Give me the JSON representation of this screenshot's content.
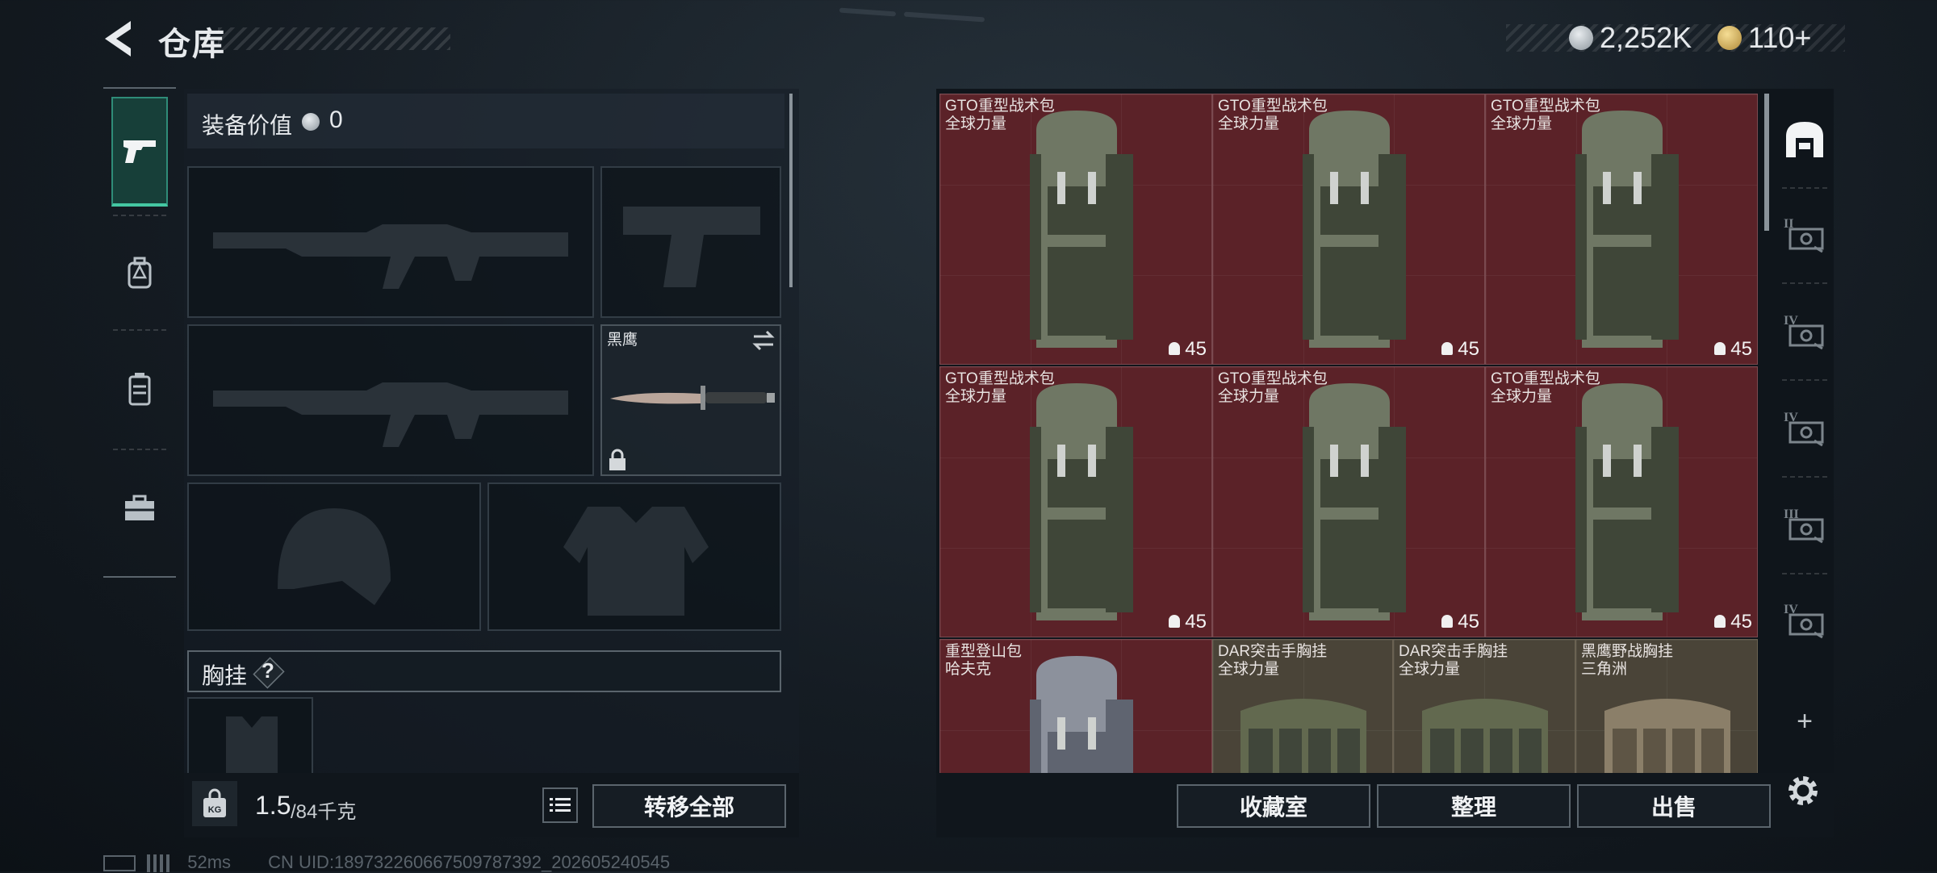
{
  "header": {
    "title": "仓库",
    "silver_amount": "2,252K",
    "gold_amount": "110+"
  },
  "tabs": [
    {
      "name": "firearms",
      "icon": "pistol-icon",
      "active": true
    },
    {
      "name": "gear",
      "icon": "backpack-icon",
      "active": false
    },
    {
      "name": "vest",
      "icon": "vest-icon",
      "active": false
    },
    {
      "name": "case",
      "icon": "toolbox-icon",
      "active": false
    }
  ],
  "equipment": {
    "value_label": "装备价值",
    "value": "0",
    "knife_name": "黑鹰",
    "chest_label": "胸挂",
    "help_label": "?",
    "weight_current": "1.5",
    "weight_max": "/84千克",
    "weight_icon_label": "KG",
    "transfer_all": "转移全部"
  },
  "inventory": {
    "items": [
      {
        "name": "GTO重型战术包",
        "sub": "全球力量",
        "count": "45",
        "kind": "backpack"
      },
      {
        "name": "GTO重型战术包",
        "sub": "全球力量",
        "count": "45",
        "kind": "backpack"
      },
      {
        "name": "GTO重型战术包",
        "sub": "全球力量",
        "count": "45",
        "kind": "backpack"
      },
      {
        "name": "GTO重型战术包",
        "sub": "全球力量",
        "count": "45",
        "kind": "backpack"
      },
      {
        "name": "GTO重型战术包",
        "sub": "全球力量",
        "count": "45",
        "kind": "backpack"
      },
      {
        "name": "GTO重型战术包",
        "sub": "全球力量",
        "count": "45",
        "kind": "backpack"
      },
      {
        "name": "重型登山包",
        "sub": "哈夫克",
        "count": "",
        "kind": "backpack-grey"
      },
      {
        "name": "DAR突击手胸挂",
        "sub": "全球力量",
        "count": "",
        "kind": "chestrig"
      },
      {
        "name": "DAR突击手胸挂",
        "sub": "全球力量",
        "count": "",
        "kind": "chestrig"
      },
      {
        "name": "黑鹰野战胸挂",
        "sub": "三角洲",
        "count": "",
        "kind": "chestrig-tan"
      }
    ],
    "side_icons": [
      {
        "icon": "storage-room-icon",
        "tier": ""
      },
      {
        "icon": "case-tier-icon",
        "tier": "II"
      },
      {
        "icon": "case-tier-icon",
        "tier": "IV"
      },
      {
        "icon": "case-tier-icon",
        "tier": "IV"
      },
      {
        "icon": "case-tier-icon",
        "tier": "III"
      },
      {
        "icon": "case-tier-icon",
        "tier": "IV"
      }
    ],
    "add_label": "+",
    "buttons": {
      "collection": "收藏室",
      "organize": "整理",
      "sell": "出售"
    }
  },
  "status": {
    "ping": "52ms",
    "uid": "CN UID:1897322606675097873​92_202605240545"
  },
  "colors": {
    "item_bg_red": "#5b2228",
    "item_bg_tan": "#4a4438",
    "tab_active": "#1f6b5c"
  }
}
